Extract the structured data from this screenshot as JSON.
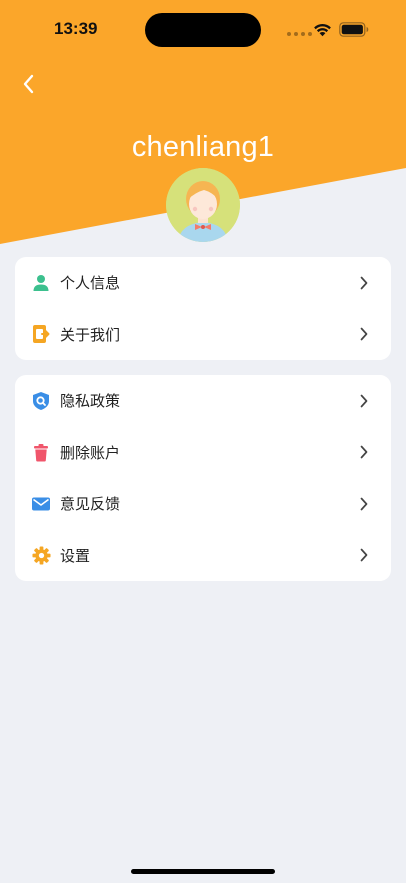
{
  "status_bar": {
    "time": "13:39"
  },
  "header": {
    "back_icon": "chevron-left-icon",
    "username": "chenliang1",
    "accent_color": "#fba62a"
  },
  "menu_groups": [
    {
      "items": [
        {
          "label": "个人信息",
          "icon": "user-icon",
          "icon_color": "#3cc08e"
        },
        {
          "label": "关于我们",
          "icon": "about-icon",
          "icon_color": "#f5a623"
        }
      ]
    },
    {
      "items": [
        {
          "label": "隐私政策",
          "icon": "privacy-shield-icon",
          "icon_color": "#3a8ee6"
        },
        {
          "label": "删除账户",
          "icon": "trash-icon",
          "icon_color": "#f0556b"
        },
        {
          "label": "意见反馈",
          "icon": "mail-icon",
          "icon_color": "#3a8ee6"
        },
        {
          "label": "设置",
          "icon": "gear-icon",
          "icon_color": "#f5a623"
        }
      ]
    }
  ]
}
